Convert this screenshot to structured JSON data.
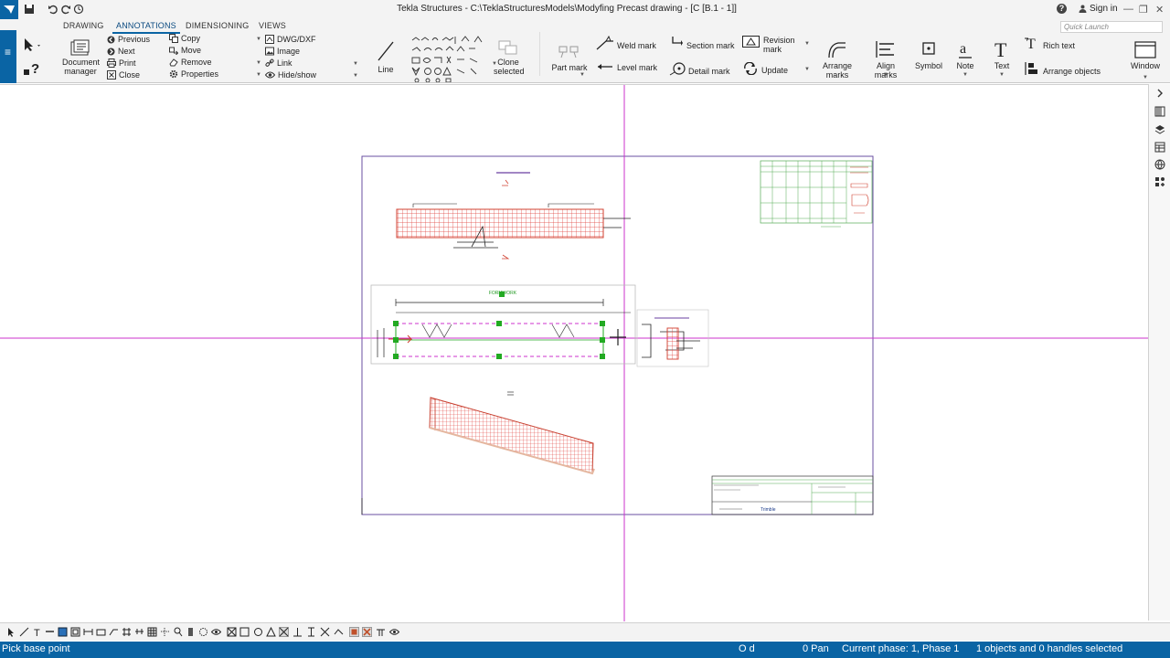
{
  "titlebar": {
    "title": "Tekla Structures - C:\\TeklaStructuresModels\\Modyfing Precast drawing - [C  [B.1 - 1]]",
    "help": "?",
    "signin": "Sign in",
    "quick_launch_placeholder": "Quick Launch"
  },
  "tabs": [
    {
      "label": "DRAWING"
    },
    {
      "label": "ANNOTATIONS"
    },
    {
      "label": "DIMENSIONING"
    },
    {
      "label": "VIEWS"
    }
  ],
  "ribbon": {
    "document_manager": "Document\nmanager",
    "nav": [
      "Previous",
      "Next",
      "Print",
      "Close"
    ],
    "edit": [
      "Copy",
      "Move",
      "Remove",
      "Properties"
    ],
    "insert": [
      "DWG/DXF",
      "Image",
      "Link",
      "Hide/show"
    ],
    "line": "Line",
    "clone_selected": "Clone\nselected",
    "part_mark": "Part mark",
    "weld_mark": "Weld mark",
    "level_mark": "Level mark",
    "section_mark": "Section mark",
    "detail_mark": "Detail mark",
    "revision_mark": "Revision\nmark",
    "update": "Update",
    "arrange_marks": "Arrange\nmarks",
    "align_marks": "Align marks",
    "symbol": "Symbol",
    "note": "Note",
    "text": "Text",
    "rich_text": "Rich text",
    "arrange_objects": "Arrange objects",
    "window": "Window"
  },
  "drawing": {
    "formwork_label": "FORMWORK",
    "title_block_brand": "Trimble"
  },
  "status": {
    "prompt": "Pick base point",
    "coord_mode": "O d",
    "pan": "0  Pan",
    "phase": "Current phase: 1, Phase 1",
    "selection": "1 objects and 0 handles selected"
  },
  "colors": {
    "accent": "#0a64a4",
    "crosshair": "#cc33cc",
    "rebar": "#e0403a",
    "handle": "#22aa22"
  }
}
